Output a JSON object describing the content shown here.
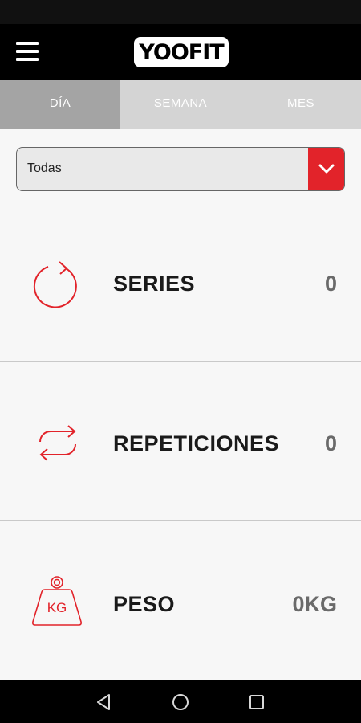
{
  "app": {
    "logo_text": "YOOFIT"
  },
  "tabs": [
    {
      "label": "DÍA",
      "active": true
    },
    {
      "label": "SEMANA",
      "active": false
    },
    {
      "label": "MES",
      "active": false
    }
  ],
  "filter": {
    "selected": "Todas"
  },
  "stats": [
    {
      "label": "SERIES",
      "value": "0",
      "icon": "refresh-icon"
    },
    {
      "label": "REPETICIONES",
      "value": "0",
      "icon": "swap-arrows-icon"
    },
    {
      "label": "PESO",
      "value": "0KG",
      "icon": "kettlebell-weight-icon",
      "icon_text": "KG"
    }
  ],
  "colors": {
    "accent": "#e2232a",
    "appbar": "#000000",
    "tab_active": "#a4a4a4",
    "tab_bg": "#d4d4d4"
  },
  "system_nav": {
    "icons": [
      "back-icon",
      "home-icon",
      "recents-icon"
    ]
  }
}
